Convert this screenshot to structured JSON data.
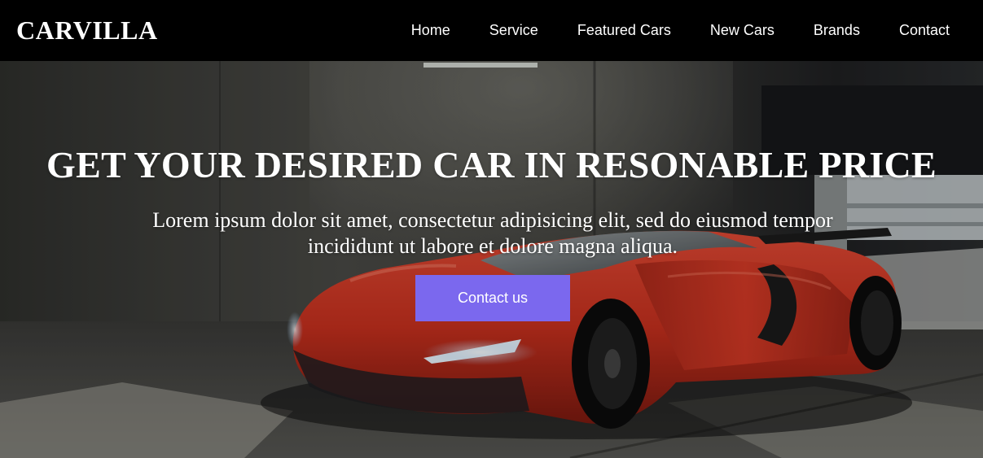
{
  "brand": {
    "name": "CARVILLA"
  },
  "nav": {
    "items": [
      {
        "label": "Home"
      },
      {
        "label": "Service"
      },
      {
        "label": "Featured Cars"
      },
      {
        "label": "New Cars"
      },
      {
        "label": "Brands"
      },
      {
        "label": "Contact"
      }
    ]
  },
  "hero": {
    "title": "GET YOUR DESIRED CAR IN RESONABLE PRICE",
    "description": "Lorem ipsum dolor sit amet, consectetur adipisicing elit, sed do eiusmod tempor incididunt ut labore et dolore magna aliqua.",
    "cta_label": "Contact us"
  },
  "colors": {
    "header_bg": "#000000",
    "accent": "#7b68ee",
    "car_red": "#c8311f",
    "text": "#ffffff"
  }
}
